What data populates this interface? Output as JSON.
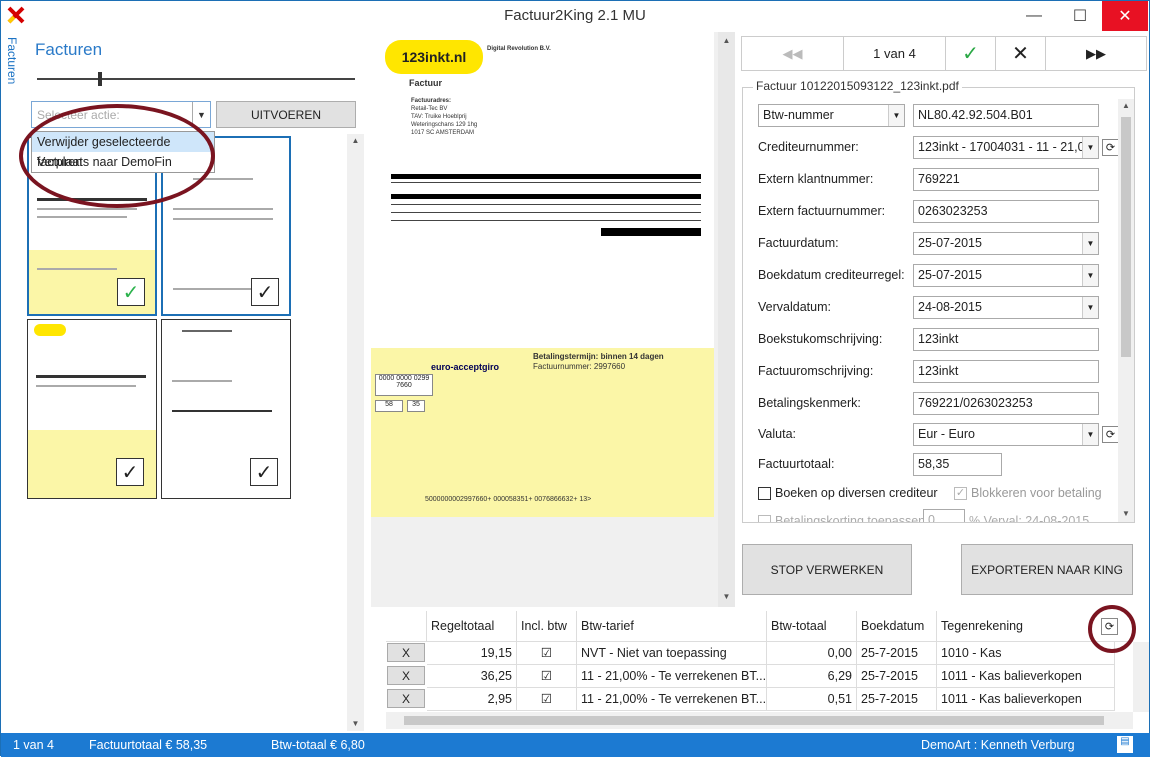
{
  "window": {
    "title": "Factuur2King 2.1 MU",
    "minimize": "—",
    "maximize": "☐",
    "close": "✕"
  },
  "sidebar": {
    "vertical_tab": "Facturen",
    "title": "Facturen",
    "action_placeholder": "Selecteer actie:",
    "execute_label": "UITVOEREN",
    "dropdown_items": [
      "Verwijder geselecteerde facturen",
      "Verplaats naar DemoFin"
    ]
  },
  "preview": {
    "logo": "123inkt.nl",
    "heading": "Factuur",
    "company": "Digital Revolution B.V.",
    "customer_lines": [
      "Factuuradres:",
      "Retail-Tec BV",
      "TAV: Truike Hoeblprij",
      "Weteringschans 129 1hg",
      "1017 SC AMSTERDAM"
    ],
    "giro_title": "euro-acceptgiro",
    "pay_term": "Betalingstermijn: binnen 14 dagen",
    "invoice_no_line": "Factuurnummer: 2997660",
    "amount_euro": "58",
    "amount_cent": "35",
    "ref": "0000 0000 0299 7660",
    "giro_line": "5000000002997660+        000058351+     0076866632+ 13>"
  },
  "nav": {
    "counter": "1 van 4",
    "first": "◀◀",
    "last": "▶▶"
  },
  "form": {
    "group_title": "Factuur 10122015093122_123inkt.pdf",
    "btw_select": "Btw-nummer",
    "btw_value": "NL80.42.92.504.B01",
    "fields": [
      {
        "label": "Crediteurnummer:",
        "value": "123inkt - 17004031 - 11 - 21,0"
      },
      {
        "label": "Extern klantnummer:",
        "value": "769221"
      },
      {
        "label": "Extern factuurnummer:",
        "value": "0263023253"
      },
      {
        "label": "Factuurdatum:",
        "value": "25-07-2015"
      },
      {
        "label": "Boekdatum crediteurregel:",
        "value": "25-07-2015"
      },
      {
        "label": "Vervaldatum:",
        "value": "24-08-2015"
      },
      {
        "label": "Boekstukomschrijving:",
        "value": "123inkt"
      },
      {
        "label": "Factuuromschrijving:",
        "value": "123inkt"
      },
      {
        "label": "Betalingskenmerk:",
        "value": "769221/0263023253"
      },
      {
        "label": "Valuta:",
        "value": "Eur - Euro"
      },
      {
        "label": "Factuurtotaal:",
        "value": "58,35"
      }
    ],
    "cb_diversen": "Boeken op diversen crediteur",
    "cb_blokkeren": "Blokkeren voor betaling",
    "cb_korting": "Betalingskorting toepassen",
    "korting_value": "0",
    "korting_suffix": "%  Verval: 24-08-2015"
  },
  "actions": {
    "stop": "STOP VERWERKEN",
    "export": "EXPORTEREN NAAR KING"
  },
  "grid": {
    "headers": [
      "Regeltotaal",
      "Incl. btw",
      "Btw-tarief",
      "Btw-totaal",
      "Boekdatum",
      "Tegenrekening"
    ],
    "x_label": "X",
    "rows": [
      {
        "total": "19,15",
        "btw_tarief": "NVT - Niet van toepassing",
        "btw_totaal": "0,00",
        "date": "25-7-2015",
        "account": "1010 - Kas"
      },
      {
        "total": "36,25",
        "btw_tarief": "11 - 21,00% - Te verrekenen BT...",
        "btw_totaal": "6,29",
        "date": "25-7-2015",
        "account": "1011 - Kas balieverkopen"
      },
      {
        "total": "2,95",
        "btw_tarief": "11 - 21,00% - Te verrekenen BT...",
        "btw_totaal": "0,51",
        "date": "25-7-2015",
        "account": "1011 - Kas balieverkopen"
      }
    ]
  },
  "status": {
    "counter": "1 van 4",
    "factuurtotaal": "Factuurtotaal  € 58,35",
    "btwtotaal": "Btw-totaal  € 6,80",
    "user": "DemoArt  :  Kenneth Verburg"
  },
  "colors": {
    "accent": "#1c7ad2",
    "annotation": "#7a1420",
    "giro_yellow": "#fbf6a7"
  }
}
